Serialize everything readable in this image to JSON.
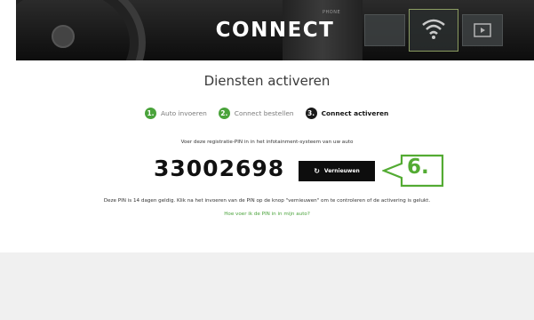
{
  "hero": {
    "title": "CONNECT",
    "phone_label": "PHONE"
  },
  "page": {
    "title": "Diensten activeren"
  },
  "steps": [
    {
      "num": "1.",
      "label": "Auto invoeren",
      "state": "done"
    },
    {
      "num": "2.",
      "label": "Connect bestellen",
      "state": "done"
    },
    {
      "num": "3.",
      "label": "Connect activeren",
      "state": "active"
    }
  ],
  "activation": {
    "instruction": "Voer deze registratie-PIN in in het infotainment-systeem van uw auto",
    "pin": "33002698",
    "refresh_icon": "↻",
    "refresh_label": "Vernieuwen",
    "note": "Deze PIN is 14 dagen geldig. Klik na het invoeren van de PIN op de knop \"vernieuwen\" om te controleren of de activering is gelukt.",
    "help_link": "Hoe voer ik de PIN in in mijn auto?"
  },
  "callout": {
    "label": "6."
  },
  "colors": {
    "accent_green": "#4aa33b",
    "callout_green": "#53ab33",
    "dark": "#0d0d0d"
  }
}
